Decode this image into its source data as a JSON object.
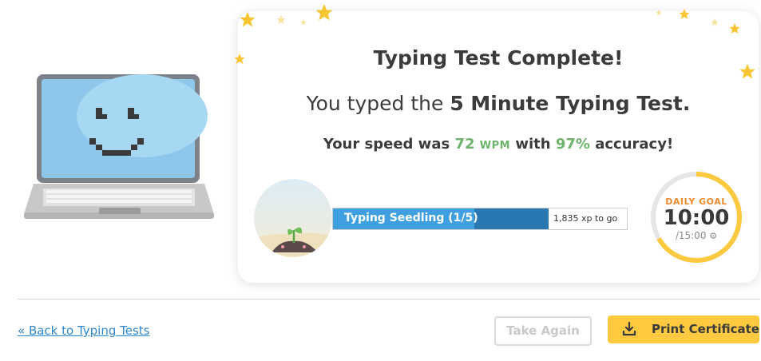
{
  "result": {
    "title": "Typing Test Complete!",
    "subtitle_prefix": "You typed the ",
    "subtitle_test": "5 Minute Typing Test.",
    "speed_prefix": "Your speed was ",
    "speed_value": "72",
    "speed_unit": "WPM",
    "speed_mid": " with ",
    "accuracy_value": "97%",
    "speed_suffix": " accuracy!"
  },
  "level": {
    "name": "Typing Seedling (1/5)",
    "xp_to_go": "1,835 xp to go",
    "progress_fraction": 0.73,
    "badge_icon": "seedling-icon"
  },
  "daily_goal": {
    "label": "DAILY GOAL",
    "time": "10:00",
    "total": "/15:00",
    "progress_fraction": 0.667,
    "settings_icon": "gear-icon"
  },
  "footer": {
    "back_link": "« Back to Typing Tests",
    "take_again": "Take Again",
    "print_certificate": "Print Certificate",
    "print_icon": "download-icon"
  },
  "colors": {
    "accent_green": "#6db36b",
    "bar_light": "#3ea0df",
    "bar_dark": "#2a78b2",
    "goal_ring": "#ffc940",
    "goal_label": "#ef8a2f",
    "link": "#2f87c9",
    "button_yellow": "#ffc940"
  }
}
